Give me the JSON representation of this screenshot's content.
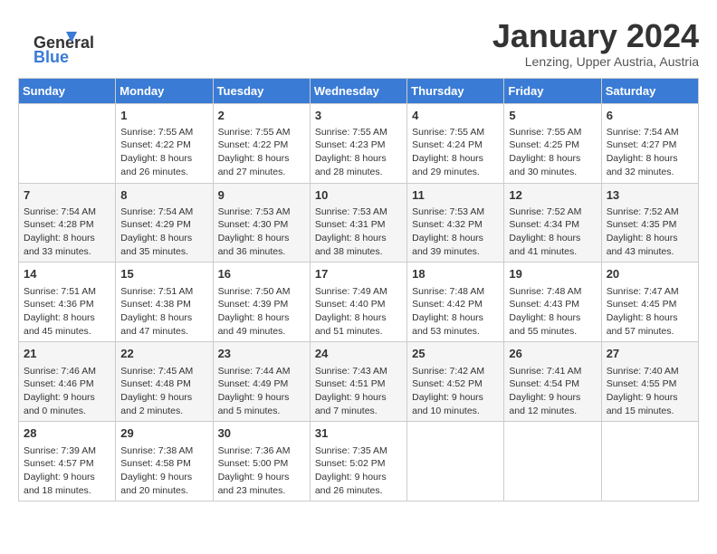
{
  "header": {
    "logo_general": "General",
    "logo_blue": "Blue",
    "month_year": "January 2024",
    "location": "Lenzing, Upper Austria, Austria"
  },
  "days_of_week": [
    "Sunday",
    "Monday",
    "Tuesday",
    "Wednesday",
    "Thursday",
    "Friday",
    "Saturday"
  ],
  "weeks": [
    [
      {
        "day": "",
        "info": ""
      },
      {
        "day": "1",
        "info": "Sunrise: 7:55 AM\nSunset: 4:22 PM\nDaylight: 8 hours\nand 26 minutes."
      },
      {
        "day": "2",
        "info": "Sunrise: 7:55 AM\nSunset: 4:22 PM\nDaylight: 8 hours\nand 27 minutes."
      },
      {
        "day": "3",
        "info": "Sunrise: 7:55 AM\nSunset: 4:23 PM\nDaylight: 8 hours\nand 28 minutes."
      },
      {
        "day": "4",
        "info": "Sunrise: 7:55 AM\nSunset: 4:24 PM\nDaylight: 8 hours\nand 29 minutes."
      },
      {
        "day": "5",
        "info": "Sunrise: 7:55 AM\nSunset: 4:25 PM\nDaylight: 8 hours\nand 30 minutes."
      },
      {
        "day": "6",
        "info": "Sunrise: 7:54 AM\nSunset: 4:27 PM\nDaylight: 8 hours\nand 32 minutes."
      }
    ],
    [
      {
        "day": "7",
        "info": "Sunrise: 7:54 AM\nSunset: 4:28 PM\nDaylight: 8 hours\nand 33 minutes."
      },
      {
        "day": "8",
        "info": "Sunrise: 7:54 AM\nSunset: 4:29 PM\nDaylight: 8 hours\nand 35 minutes."
      },
      {
        "day": "9",
        "info": "Sunrise: 7:53 AM\nSunset: 4:30 PM\nDaylight: 8 hours\nand 36 minutes."
      },
      {
        "day": "10",
        "info": "Sunrise: 7:53 AM\nSunset: 4:31 PM\nDaylight: 8 hours\nand 38 minutes."
      },
      {
        "day": "11",
        "info": "Sunrise: 7:53 AM\nSunset: 4:32 PM\nDaylight: 8 hours\nand 39 minutes."
      },
      {
        "day": "12",
        "info": "Sunrise: 7:52 AM\nSunset: 4:34 PM\nDaylight: 8 hours\nand 41 minutes."
      },
      {
        "day": "13",
        "info": "Sunrise: 7:52 AM\nSunset: 4:35 PM\nDaylight: 8 hours\nand 43 minutes."
      }
    ],
    [
      {
        "day": "14",
        "info": "Sunrise: 7:51 AM\nSunset: 4:36 PM\nDaylight: 8 hours\nand 45 minutes."
      },
      {
        "day": "15",
        "info": "Sunrise: 7:51 AM\nSunset: 4:38 PM\nDaylight: 8 hours\nand 47 minutes."
      },
      {
        "day": "16",
        "info": "Sunrise: 7:50 AM\nSunset: 4:39 PM\nDaylight: 8 hours\nand 49 minutes."
      },
      {
        "day": "17",
        "info": "Sunrise: 7:49 AM\nSunset: 4:40 PM\nDaylight: 8 hours\nand 51 minutes."
      },
      {
        "day": "18",
        "info": "Sunrise: 7:48 AM\nSunset: 4:42 PM\nDaylight: 8 hours\nand 53 minutes."
      },
      {
        "day": "19",
        "info": "Sunrise: 7:48 AM\nSunset: 4:43 PM\nDaylight: 8 hours\nand 55 minutes."
      },
      {
        "day": "20",
        "info": "Sunrise: 7:47 AM\nSunset: 4:45 PM\nDaylight: 8 hours\nand 57 minutes."
      }
    ],
    [
      {
        "day": "21",
        "info": "Sunrise: 7:46 AM\nSunset: 4:46 PM\nDaylight: 9 hours\nand 0 minutes."
      },
      {
        "day": "22",
        "info": "Sunrise: 7:45 AM\nSunset: 4:48 PM\nDaylight: 9 hours\nand 2 minutes."
      },
      {
        "day": "23",
        "info": "Sunrise: 7:44 AM\nSunset: 4:49 PM\nDaylight: 9 hours\nand 5 minutes."
      },
      {
        "day": "24",
        "info": "Sunrise: 7:43 AM\nSunset: 4:51 PM\nDaylight: 9 hours\nand 7 minutes."
      },
      {
        "day": "25",
        "info": "Sunrise: 7:42 AM\nSunset: 4:52 PM\nDaylight: 9 hours\nand 10 minutes."
      },
      {
        "day": "26",
        "info": "Sunrise: 7:41 AM\nSunset: 4:54 PM\nDaylight: 9 hours\nand 12 minutes."
      },
      {
        "day": "27",
        "info": "Sunrise: 7:40 AM\nSunset: 4:55 PM\nDaylight: 9 hours\nand 15 minutes."
      }
    ],
    [
      {
        "day": "28",
        "info": "Sunrise: 7:39 AM\nSunset: 4:57 PM\nDaylight: 9 hours\nand 18 minutes."
      },
      {
        "day": "29",
        "info": "Sunrise: 7:38 AM\nSunset: 4:58 PM\nDaylight: 9 hours\nand 20 minutes."
      },
      {
        "day": "30",
        "info": "Sunrise: 7:36 AM\nSunset: 5:00 PM\nDaylight: 9 hours\nand 23 minutes."
      },
      {
        "day": "31",
        "info": "Sunrise: 7:35 AM\nSunset: 5:02 PM\nDaylight: 9 hours\nand 26 minutes."
      },
      {
        "day": "",
        "info": ""
      },
      {
        "day": "",
        "info": ""
      },
      {
        "day": "",
        "info": ""
      }
    ]
  ]
}
